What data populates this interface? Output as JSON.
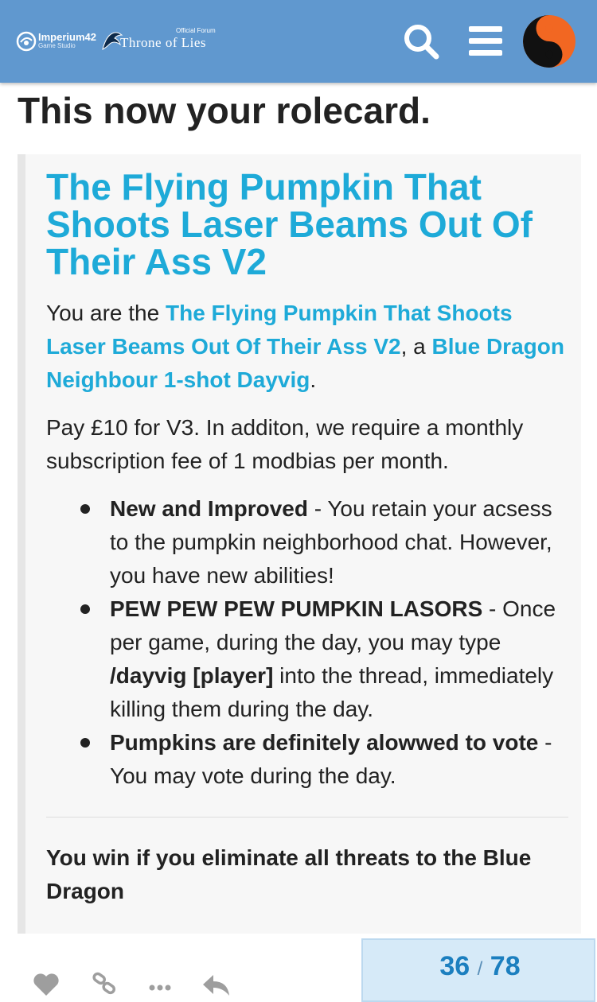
{
  "header": {
    "imperium_line1": "Imperium42",
    "imperium_line2": "Game Studio",
    "tol_small": "Official Forum",
    "tol_big": "Throne of Lies",
    "colors": {
      "bar": "#6098cf",
      "avatar_orange": "#f26722"
    }
  },
  "page": {
    "title": "This now your rolecard."
  },
  "rolecard": {
    "name": "The Flying Pumpkin That Shoots Laser Beams Out Of Their Ass V2",
    "intro_prefix": "You are the ",
    "intro_role": "The Flying Pumpkin That Shoots Laser Beams Out Of Their Ass V2",
    "intro_mid": ", a ",
    "intro_class": "Blue Dragon Neighbour 1-shot Dayvig",
    "intro_suffix": ".",
    "description": "Pay £10 for V3. In additon, we require a monthly subscription fee of 1 modbias per month.",
    "abilities": [
      {
        "name": "New and Improved",
        "sep": " - ",
        "text": "You retain your acsess to the pumpkin neighborhood chat. However, you have new abilities!"
      },
      {
        "name": "PEW PEW PEW PUMPKIN LASORS",
        "sep": " - ",
        "text_before": "Once per game, during the day, you may type ",
        "command": "/dayvig [player]",
        "text_after": " into the thread, immediately killing them during the day."
      },
      {
        "name": "Pumpkins are definitely alowwed to vote",
        "sep": " - ",
        "text": "You may vote during the day."
      }
    ],
    "win_condition": "You win if you eliminate all threats to the Blue Dragon",
    "accent_color": "#1eaad8"
  },
  "timeline": {
    "current": "36",
    "separator": "/",
    "total": "78"
  },
  "actions": {
    "icons": [
      "heart-icon",
      "link-icon",
      "more-icon",
      "reply-icon"
    ]
  }
}
